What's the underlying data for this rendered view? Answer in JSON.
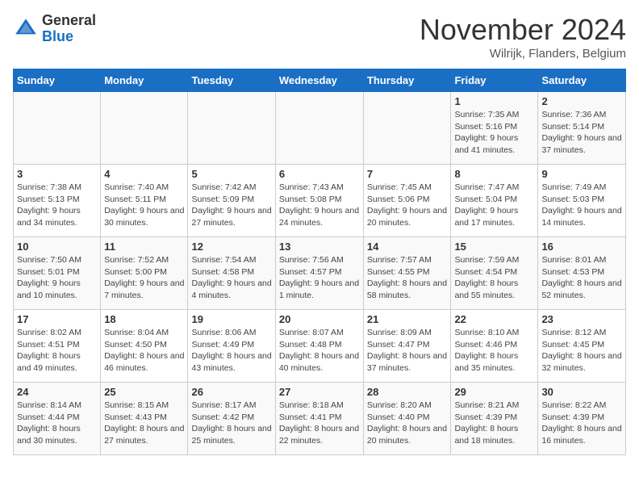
{
  "header": {
    "logo_general": "General",
    "logo_blue": "Blue",
    "month_title": "November 2024",
    "subtitle": "Wilrijk, Flanders, Belgium"
  },
  "weekdays": [
    "Sunday",
    "Monday",
    "Tuesday",
    "Wednesday",
    "Thursday",
    "Friday",
    "Saturday"
  ],
  "weeks": [
    [
      {
        "day": "",
        "info": ""
      },
      {
        "day": "",
        "info": ""
      },
      {
        "day": "",
        "info": ""
      },
      {
        "day": "",
        "info": ""
      },
      {
        "day": "",
        "info": ""
      },
      {
        "day": "1",
        "info": "Sunrise: 7:35 AM\nSunset: 5:16 PM\nDaylight: 9 hours and 41 minutes."
      },
      {
        "day": "2",
        "info": "Sunrise: 7:36 AM\nSunset: 5:14 PM\nDaylight: 9 hours and 37 minutes."
      }
    ],
    [
      {
        "day": "3",
        "info": "Sunrise: 7:38 AM\nSunset: 5:13 PM\nDaylight: 9 hours and 34 minutes."
      },
      {
        "day": "4",
        "info": "Sunrise: 7:40 AM\nSunset: 5:11 PM\nDaylight: 9 hours and 30 minutes."
      },
      {
        "day": "5",
        "info": "Sunrise: 7:42 AM\nSunset: 5:09 PM\nDaylight: 9 hours and 27 minutes."
      },
      {
        "day": "6",
        "info": "Sunrise: 7:43 AM\nSunset: 5:08 PM\nDaylight: 9 hours and 24 minutes."
      },
      {
        "day": "7",
        "info": "Sunrise: 7:45 AM\nSunset: 5:06 PM\nDaylight: 9 hours and 20 minutes."
      },
      {
        "day": "8",
        "info": "Sunrise: 7:47 AM\nSunset: 5:04 PM\nDaylight: 9 hours and 17 minutes."
      },
      {
        "day": "9",
        "info": "Sunrise: 7:49 AM\nSunset: 5:03 PM\nDaylight: 9 hours and 14 minutes."
      }
    ],
    [
      {
        "day": "10",
        "info": "Sunrise: 7:50 AM\nSunset: 5:01 PM\nDaylight: 9 hours and 10 minutes."
      },
      {
        "day": "11",
        "info": "Sunrise: 7:52 AM\nSunset: 5:00 PM\nDaylight: 9 hours and 7 minutes."
      },
      {
        "day": "12",
        "info": "Sunrise: 7:54 AM\nSunset: 4:58 PM\nDaylight: 9 hours and 4 minutes."
      },
      {
        "day": "13",
        "info": "Sunrise: 7:56 AM\nSunset: 4:57 PM\nDaylight: 9 hours and 1 minute."
      },
      {
        "day": "14",
        "info": "Sunrise: 7:57 AM\nSunset: 4:55 PM\nDaylight: 8 hours and 58 minutes."
      },
      {
        "day": "15",
        "info": "Sunrise: 7:59 AM\nSunset: 4:54 PM\nDaylight: 8 hours and 55 minutes."
      },
      {
        "day": "16",
        "info": "Sunrise: 8:01 AM\nSunset: 4:53 PM\nDaylight: 8 hours and 52 minutes."
      }
    ],
    [
      {
        "day": "17",
        "info": "Sunrise: 8:02 AM\nSunset: 4:51 PM\nDaylight: 8 hours and 49 minutes."
      },
      {
        "day": "18",
        "info": "Sunrise: 8:04 AM\nSunset: 4:50 PM\nDaylight: 8 hours and 46 minutes."
      },
      {
        "day": "19",
        "info": "Sunrise: 8:06 AM\nSunset: 4:49 PM\nDaylight: 8 hours and 43 minutes."
      },
      {
        "day": "20",
        "info": "Sunrise: 8:07 AM\nSunset: 4:48 PM\nDaylight: 8 hours and 40 minutes."
      },
      {
        "day": "21",
        "info": "Sunrise: 8:09 AM\nSunset: 4:47 PM\nDaylight: 8 hours and 37 minutes."
      },
      {
        "day": "22",
        "info": "Sunrise: 8:10 AM\nSunset: 4:46 PM\nDaylight: 8 hours and 35 minutes."
      },
      {
        "day": "23",
        "info": "Sunrise: 8:12 AM\nSunset: 4:45 PM\nDaylight: 8 hours and 32 minutes."
      }
    ],
    [
      {
        "day": "24",
        "info": "Sunrise: 8:14 AM\nSunset: 4:44 PM\nDaylight: 8 hours and 30 minutes."
      },
      {
        "day": "25",
        "info": "Sunrise: 8:15 AM\nSunset: 4:43 PM\nDaylight: 8 hours and 27 minutes."
      },
      {
        "day": "26",
        "info": "Sunrise: 8:17 AM\nSunset: 4:42 PM\nDaylight: 8 hours and 25 minutes."
      },
      {
        "day": "27",
        "info": "Sunrise: 8:18 AM\nSunset: 4:41 PM\nDaylight: 8 hours and 22 minutes."
      },
      {
        "day": "28",
        "info": "Sunrise: 8:20 AM\nSunset: 4:40 PM\nDaylight: 8 hours and 20 minutes."
      },
      {
        "day": "29",
        "info": "Sunrise: 8:21 AM\nSunset: 4:39 PM\nDaylight: 8 hours and 18 minutes."
      },
      {
        "day": "30",
        "info": "Sunrise: 8:22 AM\nSunset: 4:39 PM\nDaylight: 8 hours and 16 minutes."
      }
    ]
  ]
}
